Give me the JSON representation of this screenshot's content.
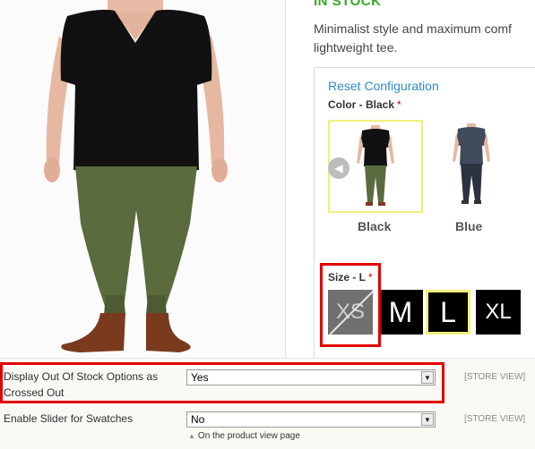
{
  "product": {
    "stock_status": "IN STOCK",
    "description_line1": "Minimalist style and maximum comf",
    "description_line2": "lightweight tee."
  },
  "configurator": {
    "reset_label": "Reset Configuration",
    "color_label": "Color - Black",
    "required_mark": "*",
    "color_swatches": [
      {
        "label": "Black",
        "selected": true
      },
      {
        "label": "Blue",
        "selected": false
      }
    ],
    "slider_arrow_icon": "chevron-left-icon",
    "size_label": "Size - L",
    "sizes": [
      {
        "label": "XS",
        "available": false
      },
      {
        "label": "M",
        "available": true
      },
      {
        "label": "L",
        "available": true,
        "selected": true
      },
      {
        "label": "XL",
        "available": true
      }
    ]
  },
  "admin_options": [
    {
      "label": "Display Out Of Stock Options as Crossed Out",
      "value": "Yes",
      "scope": "[STORE VIEW]"
    },
    {
      "label": "Enable Slider for Swatches",
      "value": "No",
      "scope": "[STORE VIEW]",
      "note": "On the product view page"
    }
  ],
  "colors": {
    "stock_green": "#3aa52a",
    "link_blue": "#2b8ec7",
    "highlight_red": "#e20000",
    "selected_yellow": "#f0f07a"
  }
}
